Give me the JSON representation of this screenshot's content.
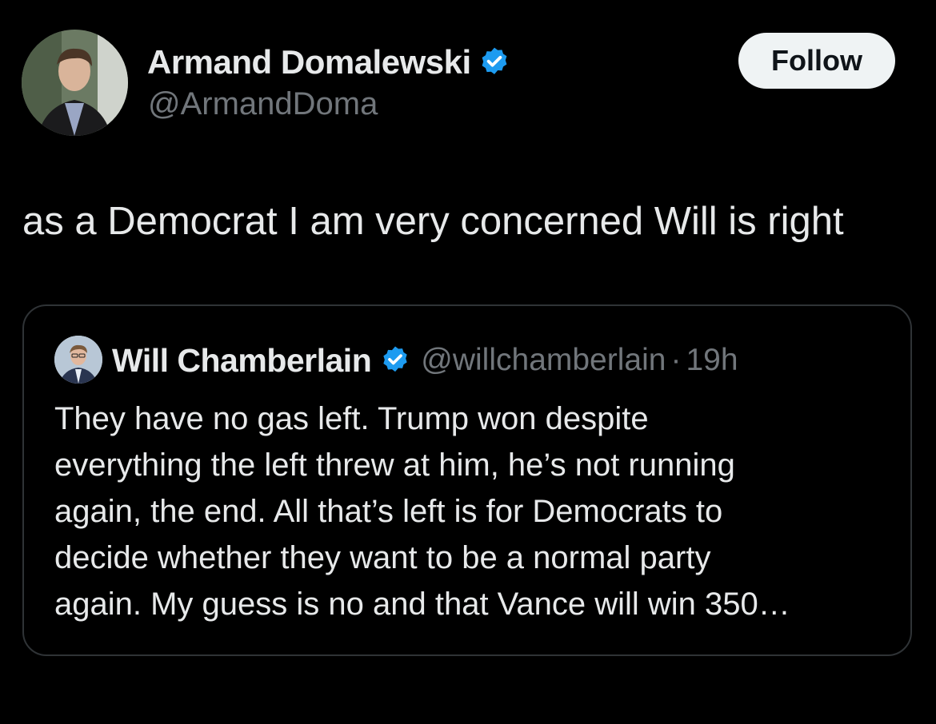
{
  "author": {
    "name": "Armand Domalewski",
    "handle": "@ArmandDoma",
    "verified": true
  },
  "follow_button": {
    "label": "Follow"
  },
  "tweet": {
    "text": "as a Democrat I am very concerned Will is right"
  },
  "quoted_tweet": {
    "name": "Will Chamberlain",
    "handle": "@willchamberlain",
    "separator": "·",
    "time": "19h",
    "verified": true,
    "lines": [
      "They have no gas left. Trump won despite",
      "everything the left threw at him, he’s not running",
      "again, the end. All that’s left is for Democrats to",
      "decide whether they want to be a normal party",
      "again. My guess is no and that Vance will win 350…"
    ]
  },
  "colors": {
    "background": "#000000",
    "text_primary": "#e7e9ea",
    "text_secondary": "#71767b",
    "verified_blue": "#1d9bf0",
    "border": "#2f3336",
    "follow_bg": "#eff3f4"
  }
}
